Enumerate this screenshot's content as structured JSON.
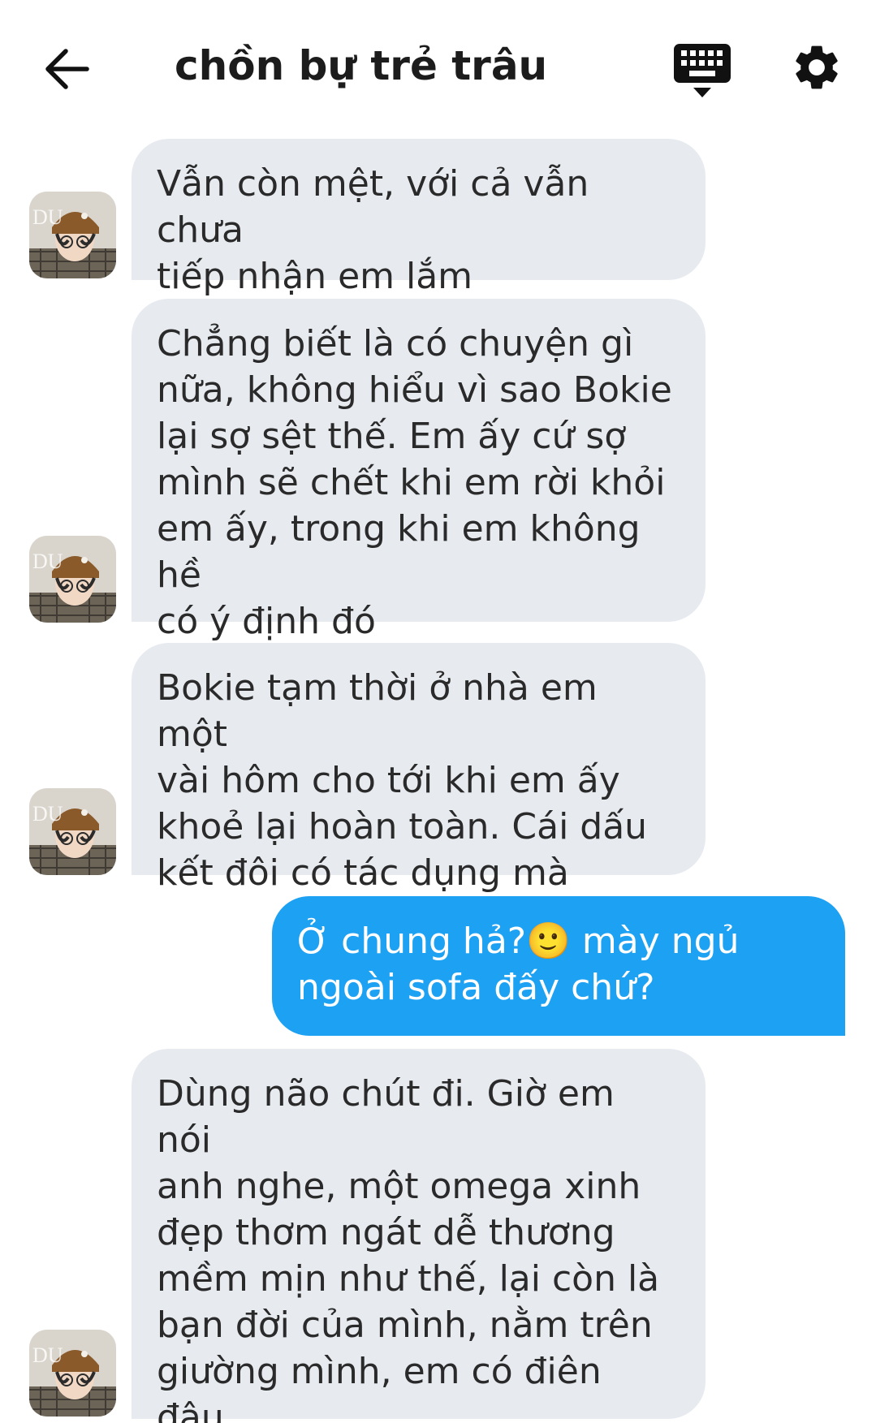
{
  "header": {
    "title": "chồn bự trẻ trâu"
  },
  "icons": {
    "back": "arrow-left-icon",
    "keyboard": "keyboard-icon",
    "settings": "gear-icon"
  },
  "colors": {
    "incoming_bubble": "#e7ebf0",
    "outgoing_bubble": "#1da1f2",
    "text": "#2a2a2a"
  },
  "messages": [
    {
      "direction": "incoming",
      "text": "Vẫn còn mệt, với cả vẫn chưa\ntiếp nhận em lắm"
    },
    {
      "direction": "incoming",
      "text": "Chẳng biết là có chuyện gì\nnữa, không hiểu vì sao Bokie\nlại sợ sệt thế. Em ấy cứ sợ\nmình sẽ chết khi em rời khỏi\nem ấy, trong khi em không hề\ncó ý định đó"
    },
    {
      "direction": "incoming",
      "text": "Bokie tạm thời ở nhà em một\nvài hôm cho tới khi em ấy\nkhoẻ lại hoàn toàn. Cái dấu\nkết đôi có tác dụng mà"
    },
    {
      "direction": "outgoing",
      "text": "Ở chung hả?🙂 mày ngủ\nngoài sofa đấy chứ?"
    },
    {
      "direction": "incoming",
      "text": "Dùng não chút đi. Giờ em nói\nanh nghe, một omega xinh\nđẹp thơm ngát dễ thương\nmềm mịn như thế, lại còn là\nbạn đời của mình, nằm trên\ngiường mình, em có điên đâu\nmà ra sofa nằm cơ chứ?🙂"
    }
  ]
}
